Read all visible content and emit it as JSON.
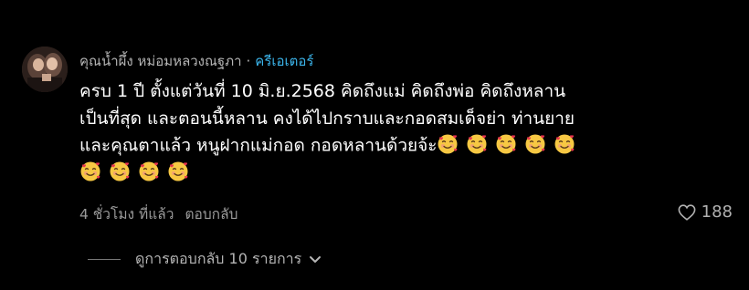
{
  "comment": {
    "author": "คุณน้ำผึ้ง หม่อมหลวงณฐภา",
    "separator": "·",
    "creator_badge": "ครีเอเตอร์",
    "body_lines": [
      "ครบ 1 ปี ตั้งแต่วันที่ 10 มิ.ย.2568 คิดถึงแม่ คิดถึงพ่อ คิดถึงหลาน",
      "เป็นที่สุด และตอนนี้หลาน คงได้ไปกราบและกอดสมเด็จย่า ท่านยาย",
      "และคุณตาแล้ว หนูฝากแม่กอด กอดหลานด้วยจ้ะ"
    ],
    "emoji": "smiling-face-with-hearts-icon",
    "emoji_count_line3": 5,
    "emoji_count_line4": 4,
    "timestamp": "4 ชั่วโมง ที่แล้ว",
    "reply_label": "ตอบกลับ",
    "like_count": "188",
    "view_replies_label": "ดูการตอบกลับ 10 รายการ"
  },
  "colors": {
    "background": "#000000",
    "text": "#ffffff",
    "secondary": "#9a9a9a",
    "creator_accent": "#3bb4ea"
  }
}
